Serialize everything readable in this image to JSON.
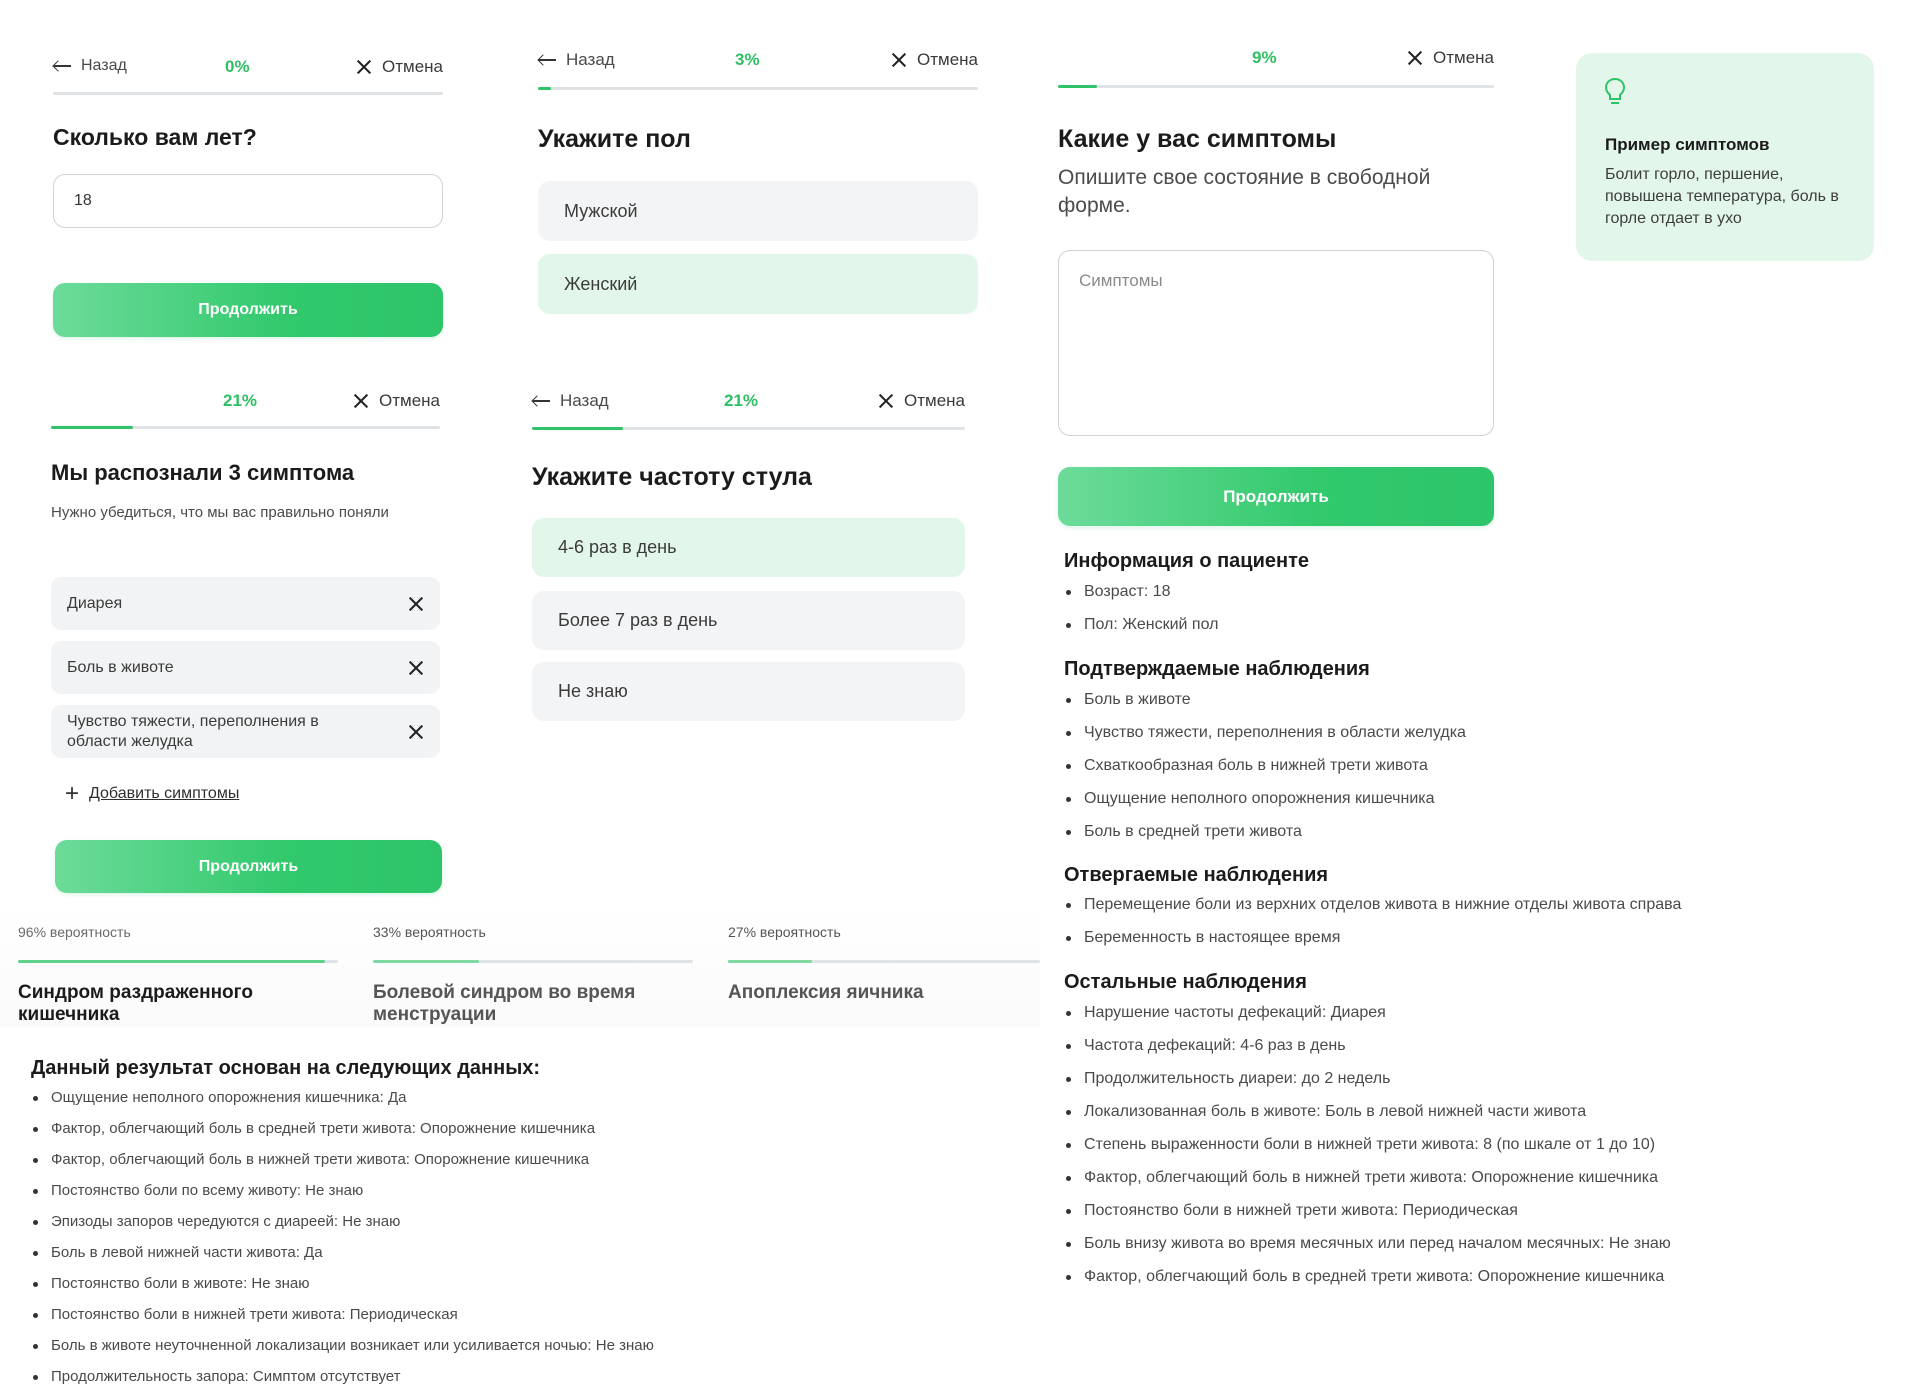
{
  "age_screen": {
    "back": "Назад",
    "progress": "0%",
    "progress_value": 0,
    "cancel": "Отмена",
    "title": "Сколько вам лет?",
    "input_value": "18",
    "continue": "Продолжить"
  },
  "gender_screen": {
    "back": "Назад",
    "progress": "3%",
    "progress_value": 3,
    "cancel": "Отмена",
    "title": "Укажите пол",
    "options": [
      {
        "label": "Мужской",
        "selected": false
      },
      {
        "label": "Женский",
        "selected": true
      }
    ]
  },
  "symptoms_screen": {
    "progress": "9%",
    "progress_value": 9,
    "cancel": "Отмена",
    "title": "Какие у вас симптомы",
    "subtitle": "Опишите свое состояние в свободной форме.",
    "textarea_placeholder": "Симптомы",
    "continue": "Продолжить"
  },
  "tip": {
    "icon": "lightbulb-icon",
    "title": "Пример симптомов",
    "text": "Болит горло, першение, повышена температура, боль в горле отдает в ухо"
  },
  "recognized_screen": {
    "progress": "21%",
    "progress_value": 21,
    "cancel": "Отмена",
    "title": "Мы распознали 3 симптома",
    "subtitle": "Нужно убедиться, что мы вас правильно поняли",
    "symptoms": [
      "Диарея",
      "Боль в животе",
      "Чувство тяжести, переполнения в области желудка"
    ],
    "add": "Добавить симптомы",
    "continue": "Продолжить"
  },
  "stool_screen": {
    "back": "Назад",
    "progress": "21%",
    "progress_value": 21,
    "cancel": "Отмена",
    "title": "Укажите частоту стула",
    "options": [
      {
        "label": "4-6 раз в день",
        "selected": true
      },
      {
        "label": "Более 7 раз в день",
        "selected": false
      },
      {
        "label": "Не знаю",
        "selected": false
      }
    ]
  },
  "patient_info": {
    "info_title": "Информация о пациенте",
    "info": [
      "Возраст: 18",
      "Пол: Женский пол"
    ],
    "confirmed_title": "Подтверждаемые наблюдения",
    "confirmed": [
      "Боль в животе",
      "Чувство тяжести, переполнения в области желудка",
      "Схваткообразная боль в нижней трети живота",
      "Ощущение неполного опорожнения кишечника",
      "Боль в средней трети живота"
    ],
    "rejected_title": "Отвергаемые наблюдения",
    "rejected": [
      "Перемещение боли из верхних отделов живота в нижние отделы живота справа",
      "Беременность в настоящее время"
    ],
    "other_title": "Остальные наблюдения",
    "other": [
      "Нарушение частоты дефекаций: Диарея",
      "Частота дефекаций: 4-6 раз в день",
      "Продолжительность диареи: до 2 недель",
      "Локализованная боль в животе: Боль в левой нижней части живота",
      "Степень выраженности боли в нижней трети живота: 8 (по шкале от 1 до 10)",
      "Фактор, облегчающий боль в нижней трети живота: Опорожнение кишечника",
      "Постоянство боли в нижней трети живота: Периодическая",
      "Боль внизу живота во время месячных или перед началом месячных: Не знаю",
      "Фактор, облегчающий боль в средней трети живота: Опорожнение кишечника"
    ]
  },
  "results": [
    {
      "probability": "96% вероятность",
      "value": 96,
      "name": "Синдром раздраженного кишечника"
    },
    {
      "probability": "33% вероятность",
      "value": 33,
      "name": "Болевой синдром во время менструации"
    },
    {
      "probability": "27% вероятность",
      "value": 27,
      "name": "Апоплексия яичника"
    }
  ],
  "basis": {
    "title": "Данный результат основан на следующих данных:",
    "items": [
      "Ощущение неполного опорожнения кишечника: Да",
      "Фактор, облегчающий боль в средней трети живота: Опорожнение кишечника",
      "Фактор, облегчающий боль в нижней трети живота: Опорожнение кишечника",
      "Постоянство боли по всему животу: Не знаю",
      "Эпизоды запоров чередуются с диареей: Не знаю",
      "Боль в левой нижней части живота: Да",
      "Постоянство боли в животе: Не знаю",
      "Постоянство боли в нижней трети живота: Периодическая",
      "Боль в животе неуточненной локализации возникает или усиливается ночью: Не знаю",
      "Продолжительность запора: Симптом отсутствует"
    ]
  },
  "colors": {
    "accent": "#30c46a",
    "selected_bg": "#e2f6e9",
    "option_bg": "#f3f4f5"
  }
}
